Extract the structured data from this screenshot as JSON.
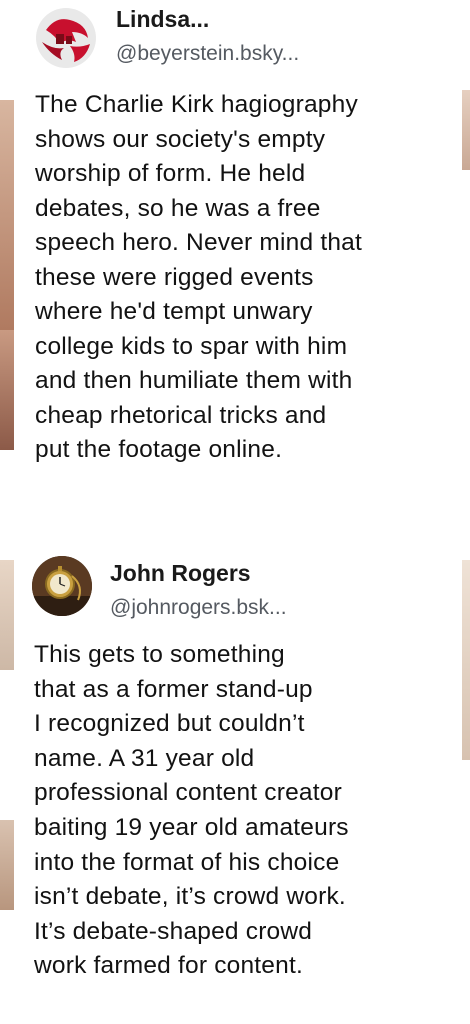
{
  "posts": [
    {
      "author_name": "Lindsa...",
      "author_handle": "@beyerstein.bsky...",
      "avatar_icon": "red-stylized-logo-avatar",
      "body_lines": [
        "The Charlie Kirk hagiography",
        "shows our society's empty",
        "worship of form. He held",
        "debates, so he was a free",
        "speech hero. Never mind that",
        "these were rigged events",
        "where he'd tempt unwary",
        "college kids to spar with him",
        "and then humiliate them with",
        "cheap rhetorical tricks and",
        "put the footage online."
      ]
    },
    {
      "author_name": "John Rogers",
      "author_handle": "@johnrogers.bsk...",
      "avatar_icon": "pocket-watch-avatar",
      "body_lines": [
        "This gets to something",
        "that as a former stand-up",
        "I recognized but couldn’t",
        "name. A 31 year old",
        "professional content creator",
        "baiting 19 year old amateurs",
        "into the format of his choice",
        "isn’t debate, it’s crowd work.",
        "It’s debate-shaped crowd",
        "work farmed for content."
      ]
    }
  ],
  "colors": {
    "text": "#121212",
    "handle": "#555a61",
    "avatar_red": "#c8102e"
  }
}
